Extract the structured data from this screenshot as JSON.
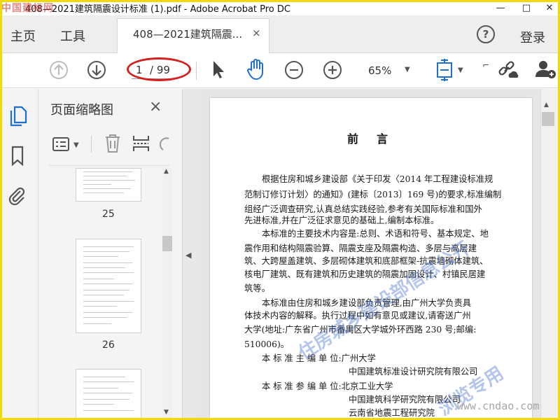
{
  "window": {
    "title": "408—2021建筑隔震设计标准 (1).pdf - Adobe Acrobat Pro DC",
    "watermark_top": "中国建标网"
  },
  "menu": {
    "home": "主页",
    "tools": "工具",
    "tab_label": "408—2021建筑隔震...",
    "tab_close": "×",
    "help": "?",
    "login": "登录"
  },
  "toolbar": {
    "current_page": "1",
    "total_pages": "/ 99",
    "zoom": "65%"
  },
  "thumbnails": {
    "title": "页面缩略图",
    "close": "×",
    "pages": [
      {
        "number": "25"
      },
      {
        "number": "26"
      },
      {
        "number": ""
      }
    ]
  },
  "document": {
    "heading": "前言",
    "lines": [
      "根据住房和城乡建设部《关于印发〈2014 年工程建设标准规",
      "范制订修订计划〉的通知》(建标〔2013〕169 号)的要求,标准编制",
      "组经广泛调查研究,认真总结实践经验,参考有关国际标准和国外",
      "先进标准,并在广泛征求意见的基础上,编制本标准。",
      "本标准的主要技术内容是:总则、术语和符号、基本规定、地",
      "震作用和结构隔震验算、隔震支座及隔震构造、多层与高层建",
      "筑、大跨屋盖建筑、多层砌体建筑和底部框架-抗震墙砌体建筑、",
      "核电厂建筑、既有建筑和历史建筑的隔震加固设计、村镇民居建",
      "筑等。",
      "本标准由住房和城乡建设部负责管理,由广州大学负责具",
      "体技术内容的解释。执行过程中如有意见或建议,请寄送广州",
      "大学(地址:广东省广州市番禺区大学城外环西路 230 号;邮编:",
      "510006)。",
      "本 标 准 主 编 单 位:广州大学",
      "中国建筑标准设计研究院有限公司",
      "本 标 准 参 编 单 位:北京工业大学",
      "中国建筑科学研究院有限公司",
      "云南省地震工程研究院"
    ]
  },
  "watermarks": {
    "diagonal_1": "住房城乡建设部信息公开",
    "diagonal_2": "浏览专用",
    "site": "www.cndao.com"
  }
}
